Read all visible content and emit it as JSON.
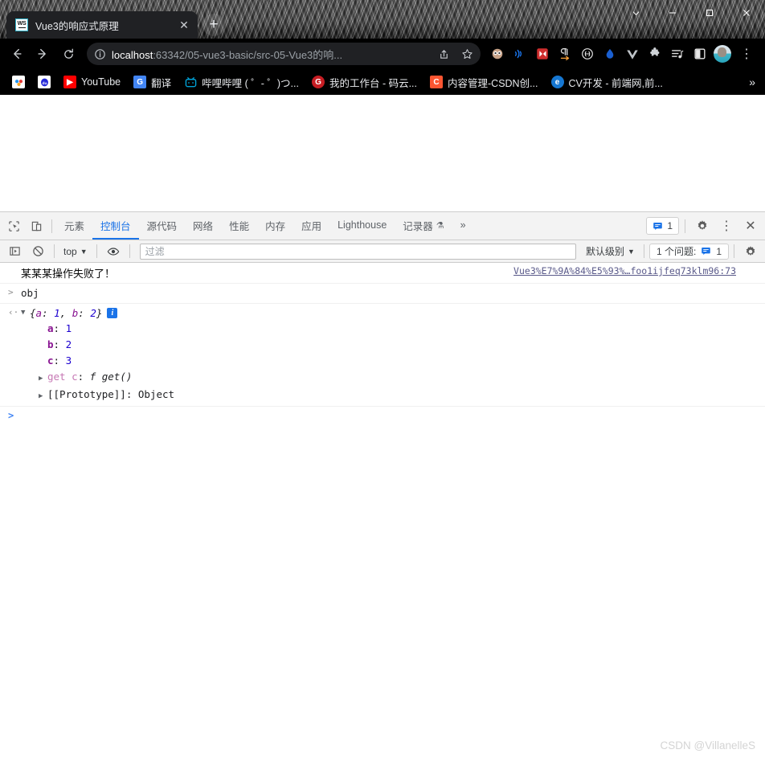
{
  "browser": {
    "tab": {
      "title": "Vue3的响应式原理",
      "favicon_label": "WS",
      "close_label": "✕"
    },
    "new_tab_label": "+",
    "window_controls": {
      "tab_search": "tab-search",
      "minimize": "minimize",
      "maximize": "maximize",
      "close": "close"
    },
    "nav": {
      "back": "back",
      "forward": "forward",
      "reload": "reload"
    },
    "omnibox": {
      "host": "localhost",
      "path": ":63342/05-vue3-basic/src-05-Vue3的响...",
      "share_label": "share",
      "bookmark_label": "bookmark"
    },
    "extensions": [
      {
        "name": "profile-extension",
        "glyph": "◕"
      },
      {
        "name": "wifi-extension",
        "glyph": "))"
      },
      {
        "name": "fast-forward-extension",
        "glyph": "⏩"
      },
      {
        "name": "paragraph-extension",
        "glyph": "¶"
      },
      {
        "name": "bracket-extension",
        "glyph": "{ }"
      },
      {
        "name": "drop-extension",
        "glyph": "◯"
      },
      {
        "name": "vue-extension",
        "glyph": "V"
      },
      {
        "name": "puzzle-extension",
        "glyph": "🧩"
      },
      {
        "name": "playlist-extension",
        "glyph": "≡♪"
      },
      {
        "name": "sidepanel-extension",
        "glyph": "▯"
      }
    ],
    "profile_label": "profile-avatar",
    "menu_label": "⋮",
    "bookmarks": [
      {
        "label": "",
        "icon_text": "",
        "icon_bg": "#ffffff",
        "name": "bookmark-jianshu"
      },
      {
        "label": "",
        "icon_text": "",
        "icon_bg": "#ffffff",
        "name": "bookmark-baidu"
      },
      {
        "label": "YouTube",
        "icon_text": "▶",
        "icon_bg": "#ff0000",
        "name": "bookmark-youtube"
      },
      {
        "label": "翻译",
        "icon_text": "G",
        "icon_bg": "#4285f4",
        "name": "bookmark-translate"
      },
      {
        "label": "哔哩哔哩 ( ゜- ゜)つ...",
        "icon_text": "📺",
        "icon_bg": "#00a1d6",
        "name": "bookmark-bilibili"
      },
      {
        "label": "我的工作台 - 码云...",
        "icon_text": "G",
        "icon_bg": "#c71d23",
        "name": "bookmark-gitee"
      },
      {
        "label": "内容管理-CSDN创...",
        "icon_text": "C",
        "icon_bg": "#fc5531",
        "name": "bookmark-csdn"
      },
      {
        "label": "CV开发 - 前端网,前...",
        "icon_text": "e",
        "icon_bg": "#1677d2",
        "name": "bookmark-cvdev"
      }
    ],
    "bookmarks_overflow": "»"
  },
  "devtools": {
    "inspect_label": "inspect-element",
    "device_label": "device-toolbar",
    "tabs": [
      {
        "label": "元素",
        "active": false,
        "name": "tab-elements"
      },
      {
        "label": "控制台",
        "active": true,
        "name": "tab-console"
      },
      {
        "label": "源代码",
        "active": false,
        "name": "tab-sources"
      },
      {
        "label": "网络",
        "active": false,
        "name": "tab-network"
      },
      {
        "label": "性能",
        "active": false,
        "name": "tab-performance"
      },
      {
        "label": "内存",
        "active": false,
        "name": "tab-memory"
      },
      {
        "label": "应用",
        "active": false,
        "name": "tab-application"
      },
      {
        "label": "Lighthouse",
        "active": false,
        "name": "tab-lighthouse"
      },
      {
        "label": "记录器",
        "active": false,
        "beaker": "⚗",
        "name": "tab-recorder"
      }
    ],
    "more_tabs": "»",
    "issues_count": "1",
    "settings_label": "settings",
    "more_label": "⋮",
    "close_label": "✕",
    "console_toolbar": {
      "sidebar_label": "console-sidebar",
      "clear_label": "clear-console",
      "context": "top",
      "context_caret": "▼",
      "eye_label": "live-expression",
      "filter_placeholder": "过滤",
      "filter_value": "",
      "level": "默认级别",
      "level_caret": "▼",
      "issues_text": "1 个问题:",
      "issues_count": "1",
      "settings_label": "console-settings"
    },
    "console": {
      "error_message": "某某某操作失败了！",
      "error_source": "Vue3%E7%9A%84%E5%93%…foo1ijfeq73klm96:73",
      "input_expression": "obj",
      "result_preview_open": "{",
      "result_preview_body": "a: 1, b: 2",
      "result_preview_close": "}",
      "result_key_a": "a",
      "result_val_a": "1",
      "result_key_b": "b",
      "result_val_b": "2",
      "info_badge": "i",
      "properties": [
        {
          "key": "a",
          "value": "1"
        },
        {
          "key": "b",
          "value": "2"
        },
        {
          "key": "c",
          "value": "3"
        }
      ],
      "getter_line_key": "get c",
      "getter_line_fn": "f get()",
      "prototype_line": "[[Prototype]]: Object",
      "expand_arrow_open": "▼",
      "expand_arrow_closed": "▶",
      "input_caret": ">",
      "output_caret": "‹·"
    }
  },
  "watermark": "CSDN @VillanelleS",
  "colors": {
    "accent": "#1a73e8",
    "chrome_dark": "#000000",
    "tab_bg": "#202124",
    "devtools_bg": "#f3f3f3",
    "key_purple": "#881391",
    "num_blue": "#1c00cf"
  }
}
